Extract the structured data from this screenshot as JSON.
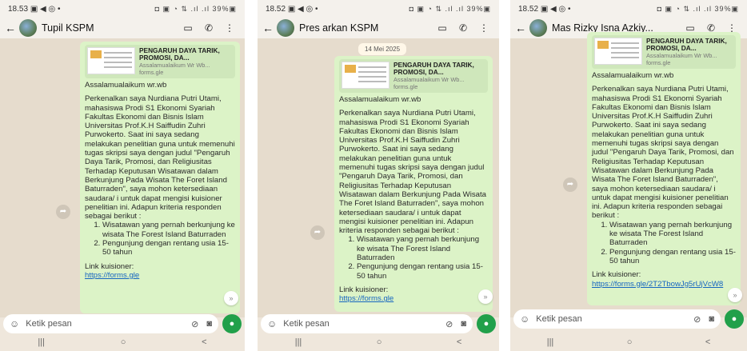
{
  "screens": [
    {
      "status_time": "18.53",
      "status_left_icons": "▣ ◀ ◎ •",
      "status_right": "◘ ▣ ◔ ⇅ .ıl .ıl 39%▣",
      "contact_name": "Tupil KSPM",
      "date_chip": "",
      "preview_title": "PENGARUH DAYA TARIK, PROMOSI, DA...",
      "preview_sub": "Assalamualaikum Wr Wb...",
      "preview_domain": "forms.gle",
      "greeting": "Assalamualaikum wr.wb",
      "body": "Perkenalkan saya Nurdiana Putri Utami, mahasiswa Prodi S1 Ekonomi Syariah Fakultas Ekonomi dan Bisnis Islam Universitas Prof.K.H Saiffudin Zuhri Purwokerto. Saat ini saya sedang melakukan penelitian guna untuk memenuhi tugas skripsi saya dengan judul \"Pengaruh Daya Tarik, Promosi, dan Religiusitas Terhadap Keputusan Wisatawan dalam Berkunjung Pada Wisata The Foret Island Baturraden\", saya mohon ketersediaan saudara/ i untuk dapat mengisi kuisioner penelitian ini. Adapun kriteria responden sebagai berikut :",
      "criteria": [
        "Wisatawan yang pernah berkunjung ke wisata The Forest Island Baturraden",
        "Pengunjung dengan rentang usia 15-50 tahun"
      ],
      "link_label": "Link kuisioner:",
      "link_url": "https://forms.gle",
      "input_placeholder": "Ketik pesan"
    },
    {
      "status_time": "18.52",
      "status_left_icons": "▣ ◀ ◎ •",
      "status_right": "◘ ▣ ◔ ⇅ .ıl .ıl 39%▣",
      "contact_name": "Pres arkan KSPM",
      "date_chip": "14 Mei 2025",
      "preview_title": "PENGARUH DAYA TARIK, PROMOSI, DA...",
      "preview_sub": "Assalamualaikum Wr Wb...",
      "preview_domain": "forms.gle",
      "greeting": "Assalamualaikum wr.wb",
      "body": "Perkenalkan saya Nurdiana Putri Utami, mahasiswa Prodi S1 Ekonomi Syariah Fakultas Ekonomi dan Bisnis Islam Universitas Prof.K.H Saiffudin Zuhri Purwokerto. Saat ini saya sedang melakukan penelitian guna untuk memenuhi tugas skripsi saya dengan judul \"Pengaruh Daya Tarik, Promosi, dan Religiusitas Terhadap Keputusan Wisatawan dalam Berkunjung Pada Wisata The Foret Island Baturraden\", saya mohon ketersediaan saudara/ i untuk dapat mengisi kuisioner penelitian ini. Adapun kriteria responden sebagai berikut :",
      "criteria": [
        "Wisatawan yang pernah berkunjung ke wisata The Forest Island Baturraden",
        "Pengunjung dengan rentang usia 15-50 tahun"
      ],
      "link_label": "Link kuisioner:",
      "link_url": "https://forms.gle",
      "input_placeholder": "Ketik pesan"
    },
    {
      "status_time": "18.52",
      "status_left_icons": "▣ ◀ ◎ •",
      "status_right": "◘ ▣ ◔ ⇅ .ıl .ıl 39%▣",
      "contact_name": "Mas Rizky Isna Azkiy...",
      "date_chip": "",
      "preview_title": "PENGARUH DAYA TARIK, PROMOSI, DA...",
      "preview_sub": "Assalamualaikum Wr Wb...",
      "preview_domain": "forms.gle",
      "greeting": "Assalamualaikum wr.wb",
      "body": "Perkenalkan saya Nurdiana Putri Utami, mahasiswa Prodi S1 Ekonomi Syariah Fakultas Ekonomi dan Bisnis Islam Universitas Prof.K.H Saiffudin Zuhri Purwokerto. Saat ini saya sedang melakukan penelitian guna untuk memenuhi tugas skripsi saya dengan judul \"Pengaruh Daya Tarik, Promosi, dan Religiusitas Terhadap Keputusan Wisatawan dalam Berkunjung Pada Wisata The Foret Island Baturraden\", saya mohon ketersediaan saudara/ i untuk dapat mengisi kuisioner penelitian ini. Adapun kriteria responden sebagai berikut :",
      "criteria": [
        "Wisatawan yang pernah berkunjung ke wisata The Forest Island Baturraden",
        "Pengunjung dengan rentang usia 15-50 tahun"
      ],
      "link_label": "Link kuisioner:",
      "link_url": "https://forms.gle/2T2TbowJg5rUjVcW8",
      "input_placeholder": "Ketik pesan"
    }
  ],
  "icons": {
    "back": "←",
    "video": "▭",
    "call": "✆",
    "menu": "⋮",
    "emoji": "☺",
    "attach": "⊘",
    "camera": "◙",
    "mic": "●",
    "forward": "➦",
    "scroll_down": "»",
    "nav_recent": "|||",
    "nav_home": "○",
    "nav_back": "<"
  },
  "colors": {
    "bubble": "#dcf3c7",
    "accent_green": "#21a04a",
    "link": "#1565c0"
  }
}
